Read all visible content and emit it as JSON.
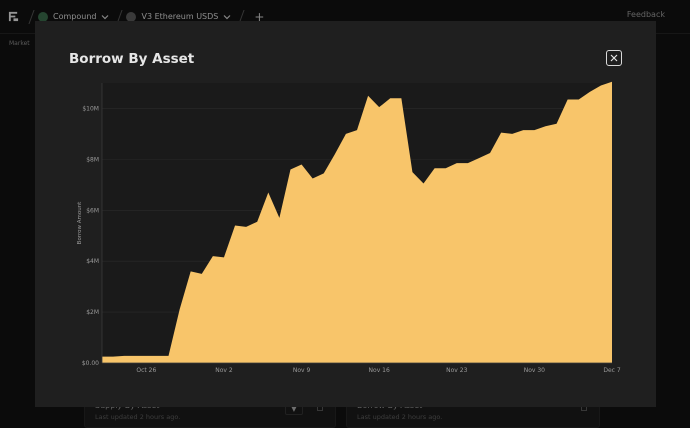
{
  "topbar": {
    "crumb1": "Compound",
    "crumb2": "V3 Ethereum USDS",
    "plus": "+",
    "feedback": "Feedback"
  },
  "subbar": {
    "text": "Market"
  },
  "cards": [
    {
      "title": "Supply By Asset",
      "subtitle": "Last updated 2 hours ago."
    },
    {
      "title": "Borrow By Asset",
      "subtitle": "Last updated 2 hours ago."
    }
  ],
  "modal": {
    "title": "Borrow By Asset"
  },
  "colors": {
    "area": "#f8c56a",
    "bg": "#1f1f1f",
    "plot": "#1a1a1a"
  },
  "chart_data": {
    "type": "area",
    "title": "Borrow By Asset",
    "xlabel": "",
    "ylabel": "Borrow Amount",
    "ylim": [
      0,
      11000000
    ],
    "y_ticks": [
      {
        "v": 0,
        "label": "$0.00"
      },
      {
        "v": 2000000,
        "label": "$2M"
      },
      {
        "v": 4000000,
        "label": "$4M"
      },
      {
        "v": 6000000,
        "label": "$6M"
      },
      {
        "v": 8000000,
        "label": "$8M"
      },
      {
        "v": 10000000,
        "label": "$10M"
      }
    ],
    "x_ticks": [
      {
        "date": "2024-10-26",
        "label": "Oct 26"
      },
      {
        "date": "2024-11-02",
        "label": "Nov 2"
      },
      {
        "date": "2024-11-09",
        "label": "Nov 9"
      },
      {
        "date": "2024-11-16",
        "label": "Nov 16"
      },
      {
        "date": "2024-11-23",
        "label": "Nov 23"
      },
      {
        "date": "2024-11-30",
        "label": "Nov 30"
      },
      {
        "date": "2024-12-07",
        "label": "Dec 7"
      }
    ],
    "x_range": [
      "2024-10-22",
      "2024-12-07"
    ],
    "grid": true,
    "series": [
      {
        "points": [
          [
            "2024-10-22",
            250000
          ],
          [
            "2024-10-23",
            250000
          ],
          [
            "2024-10-24",
            280000
          ],
          [
            "2024-10-25",
            280000
          ],
          [
            "2024-10-26",
            280000
          ],
          [
            "2024-10-27",
            280000
          ],
          [
            "2024-10-28",
            280000
          ],
          [
            "2024-10-29",
            2100000
          ],
          [
            "2024-10-30",
            3600000
          ],
          [
            "2024-10-31",
            3500000
          ],
          [
            "2024-11-01",
            4200000
          ],
          [
            "2024-11-02",
            4150000
          ],
          [
            "2024-11-03",
            5400000
          ],
          [
            "2024-11-04",
            5350000
          ],
          [
            "2024-11-05",
            5550000
          ],
          [
            "2024-11-06",
            6700000
          ],
          [
            "2024-11-07",
            5700000
          ],
          [
            "2024-11-08",
            7600000
          ],
          [
            "2024-11-09",
            7800000
          ],
          [
            "2024-11-10",
            7250000
          ],
          [
            "2024-11-11",
            7450000
          ],
          [
            "2024-11-12",
            8200000
          ],
          [
            "2024-11-13",
            9000000
          ],
          [
            "2024-11-14",
            9150000
          ],
          [
            "2024-11-15",
            10500000
          ],
          [
            "2024-11-16",
            10050000
          ],
          [
            "2024-11-17",
            10400000
          ],
          [
            "2024-11-18",
            10400000
          ],
          [
            "2024-11-19",
            7500000
          ],
          [
            "2024-11-20",
            7050000
          ],
          [
            "2024-11-21",
            7650000
          ],
          [
            "2024-11-22",
            7650000
          ],
          [
            "2024-11-23",
            7850000
          ],
          [
            "2024-11-24",
            7850000
          ],
          [
            "2024-11-25",
            8050000
          ],
          [
            "2024-11-26",
            8250000
          ],
          [
            "2024-11-27",
            9050000
          ],
          [
            "2024-11-28",
            9000000
          ],
          [
            "2024-11-29",
            9150000
          ],
          [
            "2024-11-30",
            9150000
          ],
          [
            "2024-12-01",
            9300000
          ],
          [
            "2024-12-02",
            9400000
          ],
          [
            "2024-12-03",
            10350000
          ],
          [
            "2024-12-04",
            10350000
          ],
          [
            "2024-12-05",
            10650000
          ],
          [
            "2024-12-06",
            10900000
          ],
          [
            "2024-12-07",
            11050000
          ]
        ]
      }
    ]
  }
}
